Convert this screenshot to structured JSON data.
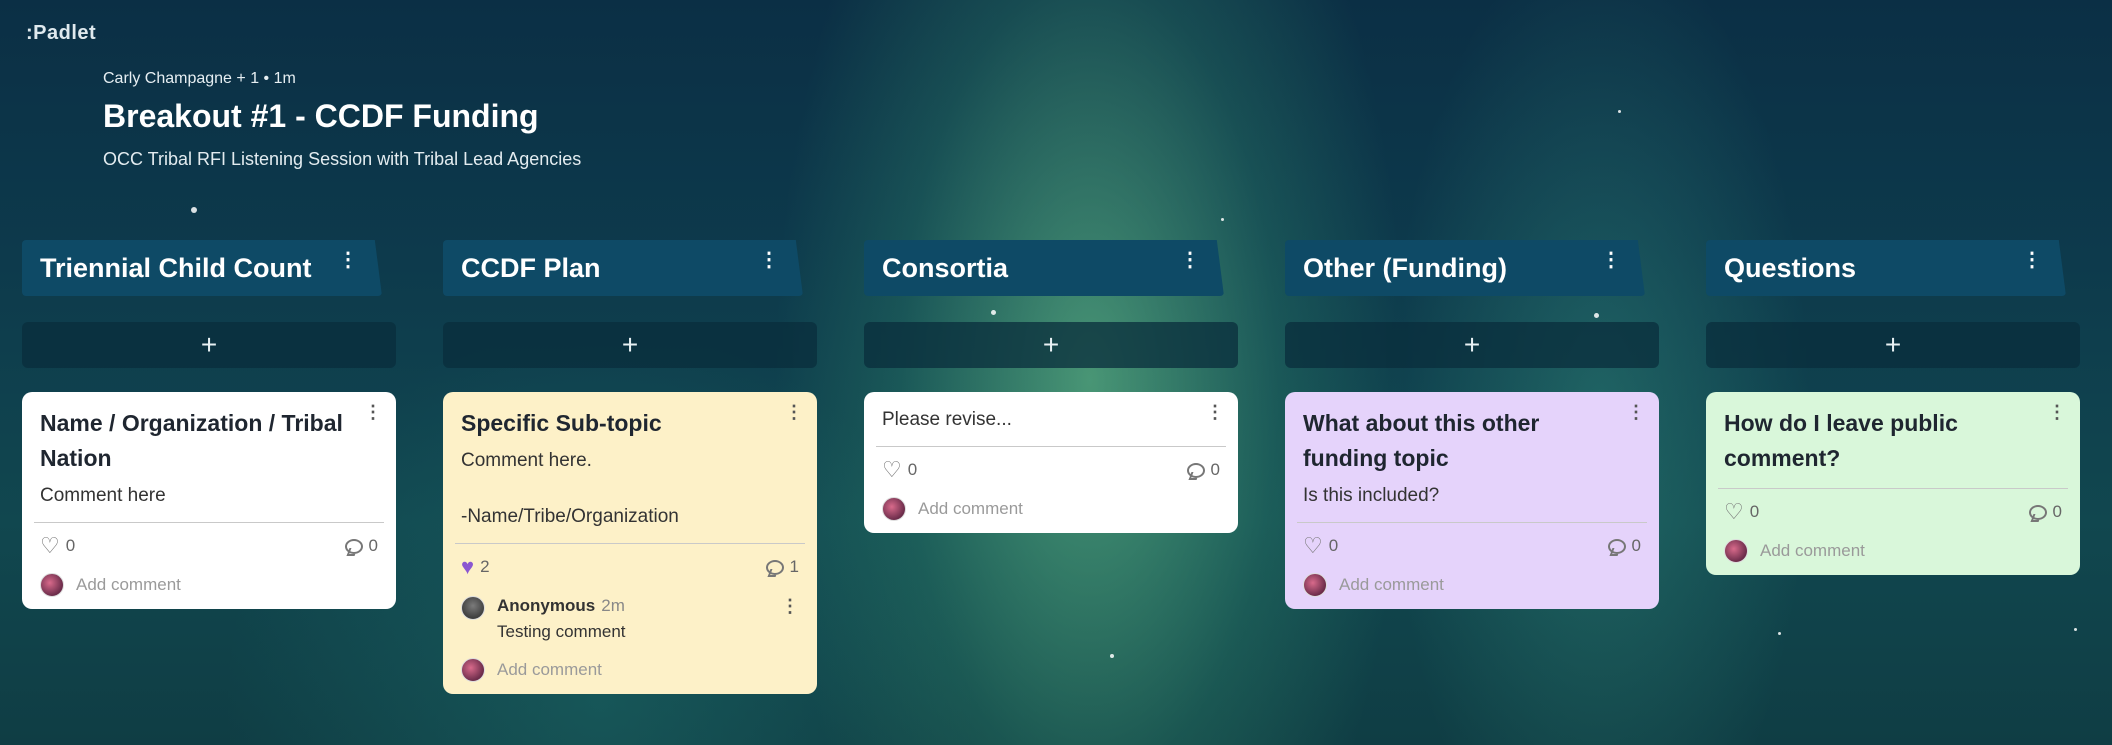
{
  "app": {
    "logo": ":Padlet"
  },
  "header": {
    "meta": "Carly Champagne + 1 • 1m",
    "title": "Breakout #1 - CCDF Funding",
    "subtitle": "OCC Tribal RFI Listening Session with Tribal Lead Agencies"
  },
  "colors": {
    "column_header": "#0e4a66",
    "card_white": "#ffffff",
    "card_yellow": "#fdf1c8",
    "card_purple": "#e5d3fb",
    "card_green": "#d9f7da",
    "heart_filled": "#8b57d1"
  },
  "add_button_label": "+",
  "menu_glyph": "⋮",
  "add_comment_placeholder": "Add comment",
  "columns": [
    {
      "title": "Triennial Child Count",
      "card": {
        "color": "#ffffff",
        "title": "Name / Organization / Tribal Nation",
        "body": "Comment here",
        "likes": "0",
        "comments": "0"
      }
    },
    {
      "title": "CCDF Plan",
      "card": {
        "color": "#fdf1c8",
        "title": "Specific Sub-topic",
        "body": "Comment here.\n\n-Name/Tribe/Organization",
        "likes": "2",
        "comments": "1",
        "comment": {
          "author": "Anonymous",
          "time": "2m",
          "text": "Testing comment"
        }
      }
    },
    {
      "title": "Consortia",
      "card": {
        "color": "#ffffff",
        "body": "Please revise...",
        "likes": "0",
        "comments": "0"
      }
    },
    {
      "title": "Other (Funding)",
      "card": {
        "color": "#e5d3fb",
        "title": "What about this other funding topic",
        "body": "Is this included?",
        "likes": "0",
        "comments": "0"
      }
    },
    {
      "title": "Questions",
      "card": {
        "color": "#d9f7da",
        "title": "How do I leave public comment?",
        "likes": "0",
        "comments": "0"
      }
    }
  ]
}
